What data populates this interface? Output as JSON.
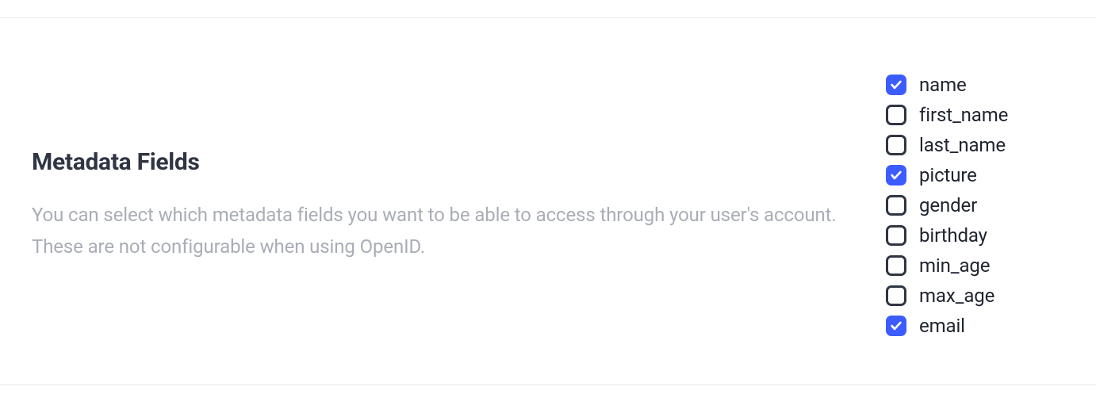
{
  "section": {
    "title": "Metadata Fields",
    "description": "You can select which metadata fields you want to be able to access through your user's account. These are not configurable when using OpenID."
  },
  "fields": [
    {
      "label": "name",
      "checked": true
    },
    {
      "label": "first_name",
      "checked": false
    },
    {
      "label": "last_name",
      "checked": false
    },
    {
      "label": "picture",
      "checked": true
    },
    {
      "label": "gender",
      "checked": false
    },
    {
      "label": "birthday",
      "checked": false
    },
    {
      "label": "min_age",
      "checked": false
    },
    {
      "label": "max_age",
      "checked": false
    },
    {
      "label": "email",
      "checked": true
    }
  ]
}
